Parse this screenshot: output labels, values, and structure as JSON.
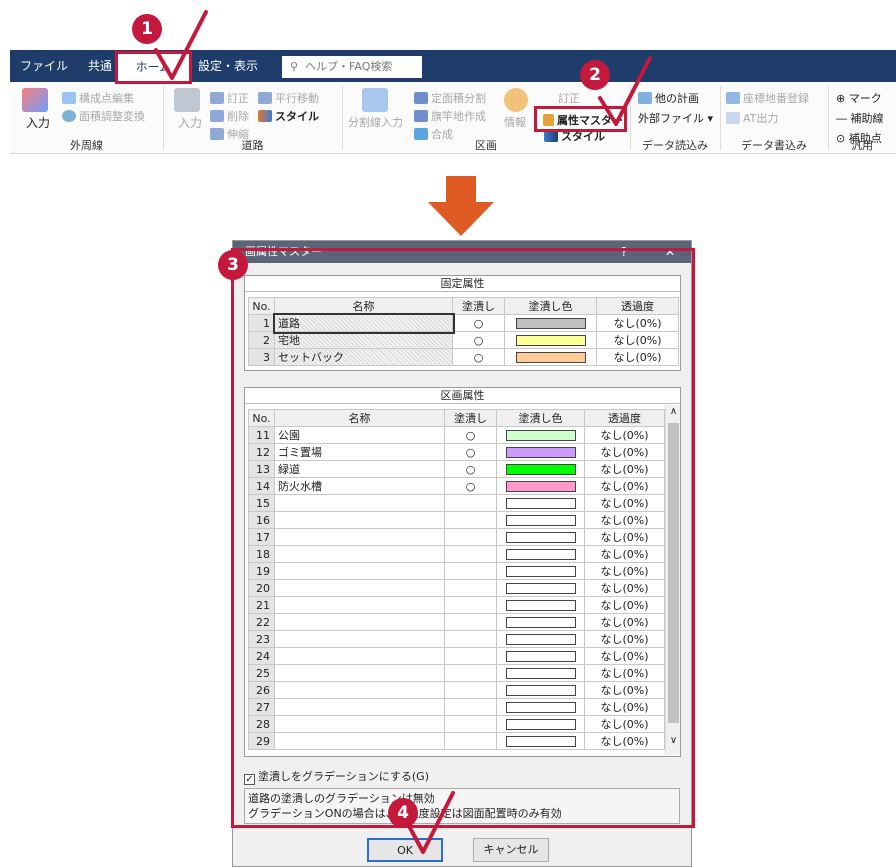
{
  "ribbon": {
    "tabs": [
      {
        "label": "ファイル"
      },
      {
        "label": "共通"
      },
      {
        "label": "ホーム"
      },
      {
        "label": "設定・表示"
      }
    ],
    "search_placeholder": "ヘルプ・FAQ検索",
    "groups": [
      {
        "label": "外周線"
      },
      {
        "label": "道路"
      },
      {
        "label": "区画"
      },
      {
        "label": "データ読込み"
      },
      {
        "label": "データ書込み"
      },
      {
        "label": "汎用"
      }
    ],
    "buttons": {
      "input1": "入力",
      "kousei": "構成点編集",
      "menseki": "面積調整変換",
      "input2": "入力",
      "teisei": "訂正",
      "heikou": "平行移動",
      "sakujo": "削除",
      "style1": "スタイル",
      "shinshuku": "伸縮",
      "bunkatsu": "分割線入力",
      "teimen": "定面積分割",
      "hatazao": "旗竿地作成",
      "gousei": "合成",
      "joho": "情報",
      "tei": "訂正",
      "zokusei": "属性マスター",
      "style2": "スタイル",
      "hoka": "他の計画",
      "gaibu": "外部ファイル",
      "zahyou": "座標地番登録",
      "at": "AT出力",
      "mark": "マーク",
      "hojosen": "補助線",
      "hojoten": "補助点"
    }
  },
  "callouts": [
    "1",
    "2",
    "3",
    "4"
  ],
  "dialog": {
    "title": "画属性マスター",
    "help": "?",
    "close": "✕",
    "fixed_section": "固定属性",
    "area_section": "区画属性",
    "columns": [
      "No.",
      "名称",
      "塗潰し",
      "塗潰し色",
      "透過度"
    ],
    "fixed_rows": [
      {
        "no": "1",
        "name": "道路",
        "fill": "○",
        "color": "#c0c0c0",
        "transparency": "なし(0%)"
      },
      {
        "no": "2",
        "name": "宅地",
        "fill": "○",
        "color": "#ffff99",
        "transparency": "なし(0%)"
      },
      {
        "no": "3",
        "name": "セットバック",
        "fill": "○",
        "color": "#ffcc99",
        "transparency": "なし(0%)"
      }
    ],
    "area_rows": [
      {
        "no": "11",
        "name": "公園",
        "fill": "○",
        "color": "#ccffcc",
        "transparency": "なし(0%)"
      },
      {
        "no": "12",
        "name": "ゴミ置場",
        "fill": "○",
        "color": "#cc99ff",
        "transparency": "なし(0%)"
      },
      {
        "no": "13",
        "name": "緑道",
        "fill": "○",
        "color": "#00ff00",
        "transparency": "なし(0%)"
      },
      {
        "no": "14",
        "name": "防火水槽",
        "fill": "○",
        "color": "#ff99cc",
        "transparency": "なし(0%)"
      },
      {
        "no": "15",
        "name": "",
        "fill": "",
        "color": "",
        "transparency": "なし(0%)"
      },
      {
        "no": "16",
        "name": "",
        "fill": "",
        "color": "",
        "transparency": "なし(0%)"
      },
      {
        "no": "17",
        "name": "",
        "fill": "",
        "color": "",
        "transparency": "なし(0%)"
      },
      {
        "no": "18",
        "name": "",
        "fill": "",
        "color": "",
        "transparency": "なし(0%)"
      },
      {
        "no": "19",
        "name": "",
        "fill": "",
        "color": "",
        "transparency": "なし(0%)"
      },
      {
        "no": "20",
        "name": "",
        "fill": "",
        "color": "",
        "transparency": "なし(0%)"
      },
      {
        "no": "21",
        "name": "",
        "fill": "",
        "color": "",
        "transparency": "なし(0%)"
      },
      {
        "no": "22",
        "name": "",
        "fill": "",
        "color": "",
        "transparency": "なし(0%)"
      },
      {
        "no": "23",
        "name": "",
        "fill": "",
        "color": "",
        "transparency": "なし(0%)"
      },
      {
        "no": "24",
        "name": "",
        "fill": "",
        "color": "",
        "transparency": "なし(0%)"
      },
      {
        "no": "25",
        "name": "",
        "fill": "",
        "color": "",
        "transparency": "なし(0%)"
      },
      {
        "no": "26",
        "name": "",
        "fill": "",
        "color": "",
        "transparency": "なし(0%)"
      },
      {
        "no": "27",
        "name": "",
        "fill": "",
        "color": "",
        "transparency": "なし(0%)"
      },
      {
        "no": "28",
        "name": "",
        "fill": "",
        "color": "",
        "transparency": "なし(0%)"
      },
      {
        "no": "29",
        "name": "",
        "fill": "",
        "color": "",
        "transparency": "なし(0%)"
      }
    ],
    "scroll_up": "∧",
    "scroll_down": "∨",
    "gradation_checkbox": "塗潰しをグラデーションにする(G)",
    "gradation_checked": true,
    "note_line1": "道路の塗潰しのグラデーションは無効",
    "note_line2": "グラデーションONの場合は、透過度設定は図面配置時のみ有効",
    "ok": "OK",
    "cancel": "キャンセル"
  }
}
